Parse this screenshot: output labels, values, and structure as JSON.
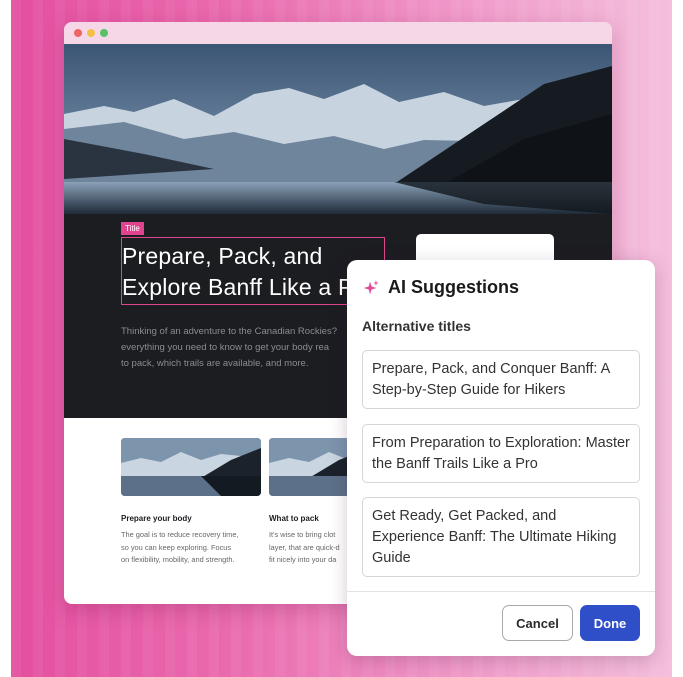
{
  "hero": {
    "title_tag": "Title",
    "title_line1": "Prepare, Pack, and",
    "title_line2": "Explore Banff Like a P",
    "description_lines": [
      "Thinking of an adventure to the Canadian Rockies?",
      "everything you need to know to get your body rea",
      "to pack, which trails are available, and more."
    ]
  },
  "cards": [
    {
      "title": "Prepare your body",
      "lines": [
        "The goal is to reduce recovery time,",
        "so you can keep exploring. Focus",
        "on flexibility, mobility, and strength."
      ]
    },
    {
      "title": "What to pack",
      "lines": [
        "It's wise to bring clot",
        "layer, that are quick-d",
        "fit nicely into your da"
      ]
    }
  ],
  "ai_panel": {
    "title": "AI Suggestions",
    "section_label": "Alternative titles",
    "suggestions": [
      "Prepare, Pack, and Conquer Banff: A Step-by-Step Guide for Hikers",
      "From Preparation to Exploration: Master the Banff Trails Like a Pro",
      "Get Ready, Get Packed, and Experience Banff: The Ultimate Hiking Guide"
    ],
    "cancel_label": "Cancel",
    "done_label": "Done"
  },
  "colors": {
    "accent_pink": "#e0448f",
    "primary_blue": "#2f4fc9",
    "dark_bg": "#1c1d21"
  },
  "icons": {
    "sparkle": "sparkle-icon"
  }
}
